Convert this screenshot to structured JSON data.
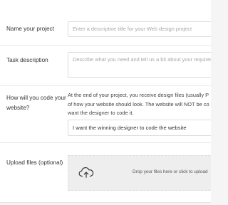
{
  "form": {
    "project_name": {
      "label": "Name your project",
      "placeholder": "Enter a descriptive title for your Web design project"
    },
    "task_description": {
      "label": "Task description",
      "placeholder": "Describe what you need and tell us a bit about your requirements"
    },
    "code_website": {
      "label_line1": "How will you code your",
      "label_line2": "website?",
      "description_line1": "At the end of your project, you receive design files (usually P",
      "description_line2": "of how your website should look. The website will NOT be co",
      "description_line3": "want the designer to code it.",
      "selected_option": "I want the winning designer to code the website"
    },
    "upload_files": {
      "label": "Upload files (optional)",
      "dropzone_text": "Drop your files here or click to upload",
      "icon": "cloud-upload-icon"
    }
  },
  "colors": {
    "page_background": "#f5f5f5",
    "card_background": "#ffffff",
    "border": "#dcdcdc",
    "placeholder": "#a8a8a8",
    "dropzone_background": "#eeeeee"
  }
}
